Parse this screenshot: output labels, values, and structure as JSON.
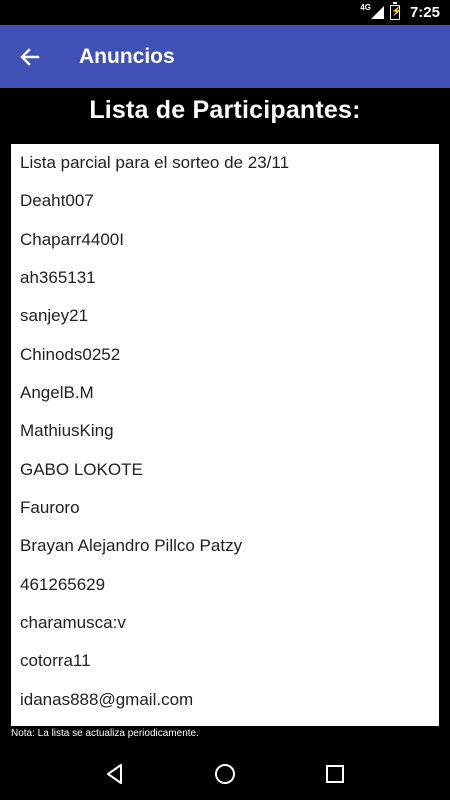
{
  "status_bar": {
    "network": "4G",
    "time": "7:25"
  },
  "toolbar": {
    "title": "Anuncios"
  },
  "header": {
    "title": "Lista de Participantes:"
  },
  "participants": [
    "Lista parcial para el sorteo de 23/11",
    "Deaht007",
    "Chaparr4400I",
    "ah365131",
    "sanjey21",
    "Chinods0252",
    "AngelB.M",
    "MathiusKing",
    "GABO LOKOTE",
    "Fauroro",
    "Brayan Alejandro Pillco Patzy",
    "461265629",
    "charamusca:v",
    "cotorra11",
    "idanas888@gmail.com"
  ],
  "note": "Nota: La lista se actualiza periodicamente.",
  "colors": {
    "toolbar": "#3F51B5",
    "background": "#000000",
    "card": "#FFFFFF"
  }
}
